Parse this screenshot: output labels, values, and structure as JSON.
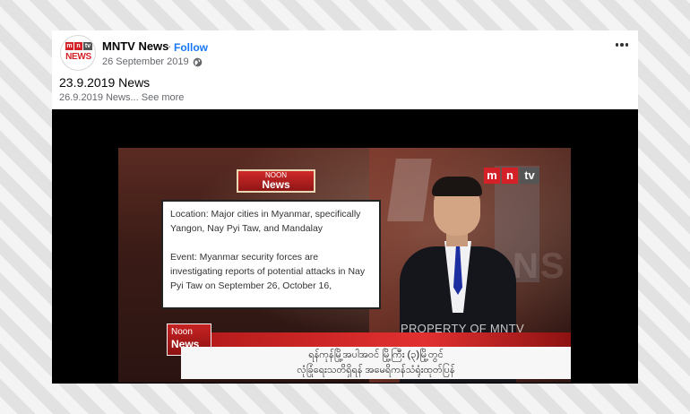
{
  "post": {
    "page_name": "MNTV News",
    "separator": "·",
    "follow_label": "Follow",
    "date": "26 September 2019",
    "privacy_icon": "globe-icon",
    "more_icon": "more-options-icon",
    "title": "23.9.2019 News",
    "snippet": "26.9.2019 News...",
    "see_more_label": "See more"
  },
  "avatar": {
    "logo_letters": [
      "m",
      "n",
      "tv"
    ],
    "logo_word": "NEWS"
  },
  "video": {
    "sign_top_line1": "NOON",
    "sign_top_line2": "News",
    "channel_logo": [
      "m",
      "n",
      "tv"
    ],
    "card_paragraphs": [
      "Location:  Major cities in Myanmar, specifically Yangon, Nay Pyi Taw, and Mandalay",
      "Event:  Myanmar security forces are investigating reports of potential attacks in Nay Pyi Taw on September 26, October 16,"
    ],
    "watermark": "PROPERTY OF MNTV",
    "badge_line1": "Noon",
    "badge_line2": "News",
    "ticker_line1": "ရန်ကုန်မြို့အပါအဝင် မြို့ကြီး (၃)မြို့တွင်",
    "ticker_line2": "လုံခြုံရေးသတိရှိရန် အမေရိကန်သံရုံးထုတ်ပြန်"
  },
  "colors": {
    "brand_red": "#d42027",
    "link_blue": "#1877f2"
  }
}
